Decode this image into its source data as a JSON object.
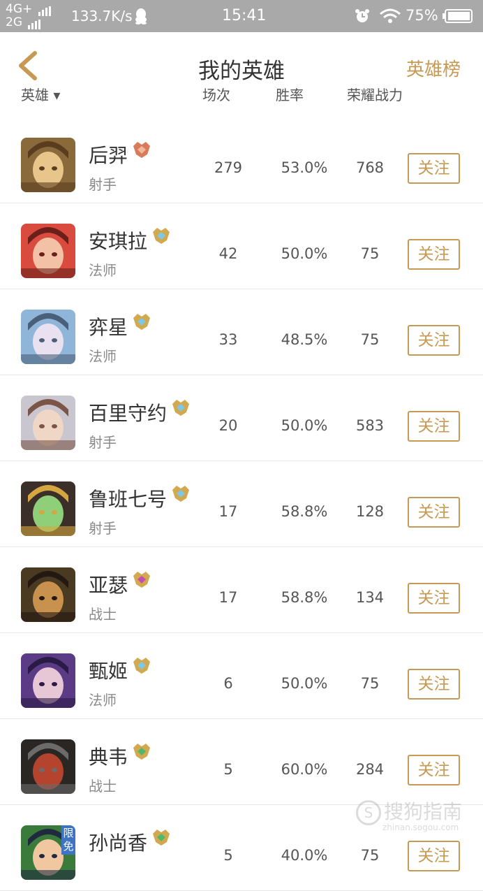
{
  "status_bar": {
    "network_top": "4G+",
    "network_bottom": "2G",
    "speed": "133.7K/s",
    "time": "15:41",
    "battery": "75%",
    "icons": [
      "qq-icon",
      "alarm-icon",
      "wifi-icon",
      "battery-icon"
    ]
  },
  "header": {
    "title": "我的英雄",
    "right_link": "英雄榜",
    "back_icon": "chevron-left-icon"
  },
  "columns": {
    "hero": "英雄 ▾",
    "games": "场次",
    "winrate": "胜率",
    "power": "荣耀战力"
  },
  "heroes": [
    {
      "name": "后羿",
      "role": "射手",
      "games": "279",
      "winrate": "53.0%",
      "power": "768",
      "rank": "bronze-rank-icon",
      "follow": "关注"
    },
    {
      "name": "安琪拉",
      "role": "法师",
      "games": "42",
      "winrate": "50.0%",
      "power": "75",
      "rank": "gold-rank-icon",
      "follow": "关注"
    },
    {
      "name": "弈星",
      "role": "法师",
      "games": "33",
      "winrate": "48.5%",
      "power": "75",
      "rank": "gold-rank-icon",
      "follow": "关注"
    },
    {
      "name": "百里守约",
      "role": "射手",
      "games": "20",
      "winrate": "50.0%",
      "power": "583",
      "rank": "gold-rank-icon",
      "follow": "关注"
    },
    {
      "name": "鲁班七号",
      "role": "射手",
      "games": "17",
      "winrate": "58.8%",
      "power": "128",
      "rank": "gold-rank-icon",
      "follow": "关注"
    },
    {
      "name": "亚瑟",
      "role": "战士",
      "games": "17",
      "winrate": "58.8%",
      "power": "134",
      "rank": "purple-rank-icon",
      "follow": "关注"
    },
    {
      "name": "甄姬",
      "role": "法师",
      "games": "6",
      "winrate": "50.0%",
      "power": "75",
      "rank": "gold-rank-icon",
      "follow": "关注"
    },
    {
      "name": "典韦",
      "role": "战士",
      "games": "5",
      "winrate": "60.0%",
      "power": "284",
      "rank": "green-rank-icon",
      "follow": "关注"
    },
    {
      "name": "孙尚香",
      "role": "",
      "games": "5",
      "winrate": "40.0%",
      "power": "75",
      "rank": "green-rank-icon",
      "follow": "关注",
      "free_badge": "限免"
    }
  ],
  "watermark": {
    "text": "搜狗指南",
    "sub": "zhinan.sogou.com"
  },
  "colors": {
    "accent": "#c69a55",
    "statusbar": "#a9a9a9"
  }
}
